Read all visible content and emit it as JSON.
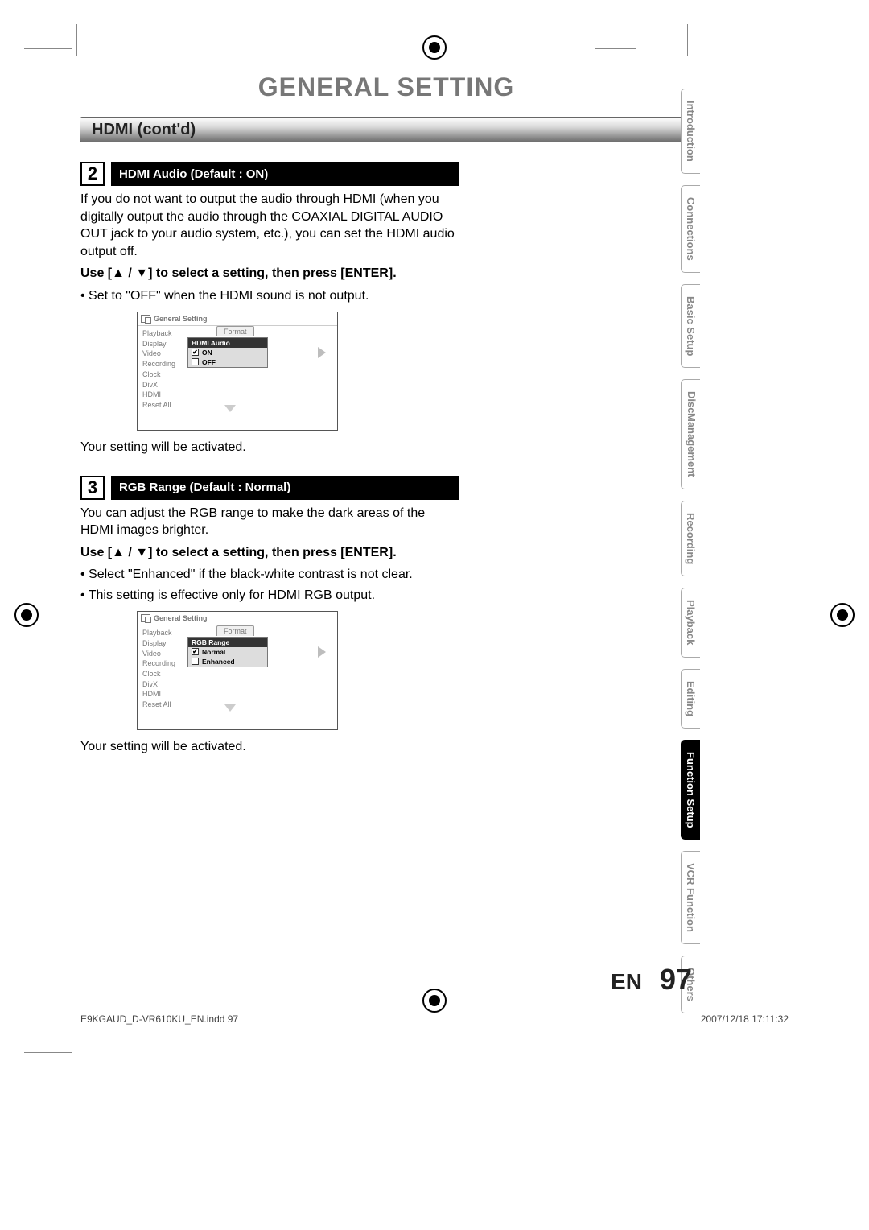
{
  "page_title": "GENERAL SETTING",
  "section_title": "HDMI (cont'd)",
  "steps": [
    {
      "num": "2",
      "label": "HDMI Audio (Default : ON)",
      "para": "If you do not want to output the audio through HDMI (when you digitally output the audio through the COAXIAL DIGITAL AUDIO OUT jack to your audio system, etc.), you can set the HDMI audio output off.",
      "instruction": "Use [▲ / ▼] to select a setting, then press [ENTER].",
      "bullets": [
        "• Set to \"OFF\" when the HDMI sound is not output."
      ],
      "closing": "Your setting will be activated."
    },
    {
      "num": "3",
      "label": "RGB Range (Default : Normal)",
      "para": "You can adjust the RGB range to make the dark areas of the HDMI images brighter.",
      "instruction": "Use [▲ / ▼] to select a setting, then press [ENTER].",
      "bullets": [
        "• Select \"Enhanced\" if the black-white contrast is not clear.",
        "• This setting is effective only for HDMI RGB output."
      ],
      "closing": "Your setting will be activated."
    }
  ],
  "osd": {
    "title": "General Setting",
    "menu": [
      "Playback",
      "Display",
      "Video",
      "Recording",
      "Clock",
      "DivX",
      "HDMI",
      "Reset All"
    ],
    "tab": "Format",
    "popups": [
      {
        "head": "HDMI Audio",
        "opts": [
          {
            "check": "✔",
            "label": "ON"
          },
          {
            "check": "",
            "label": "OFF"
          }
        ]
      },
      {
        "head": "RGB Range",
        "opts": [
          {
            "check": "✔",
            "label": "Normal"
          },
          {
            "check": "",
            "label": "Enhanced"
          }
        ]
      }
    ]
  },
  "side_tabs": [
    {
      "label": "Introduction"
    },
    {
      "label": "Connections"
    },
    {
      "label": "Basic Setup"
    },
    {
      "label": "Disc Management",
      "double": true,
      "line1": "Disc",
      "line2": "Management"
    },
    {
      "label": "Recording"
    },
    {
      "label": "Playback"
    },
    {
      "label": "Editing"
    },
    {
      "label": "Function Setup",
      "active": true
    },
    {
      "label": "VCR Function"
    },
    {
      "label": "Others"
    }
  ],
  "footer": {
    "lang": "EN",
    "page": "97"
  },
  "print_footer": {
    "left": "E9KGAUD_D-VR610KU_EN.indd   97",
    "right": "2007/12/18   17:11:32"
  }
}
